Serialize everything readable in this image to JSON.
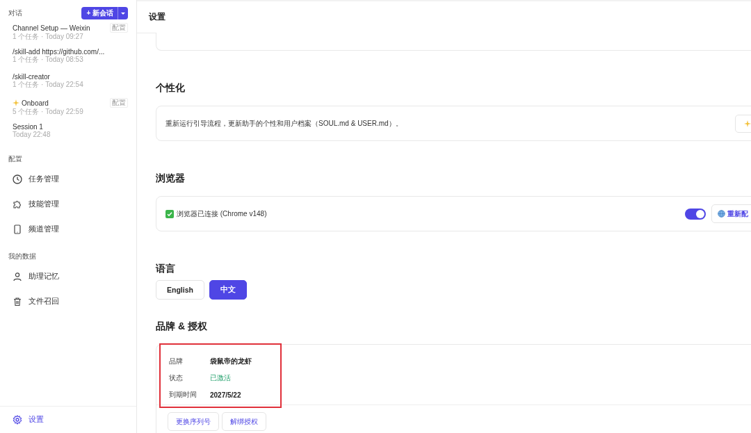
{
  "sidebar": {
    "conversations_label": "对话",
    "new_chat_button": {
      "label": "+ 新会话"
    },
    "sessions": [
      {
        "title": "Channel Setup — Weixin",
        "sparkle": false,
        "meta": "1 个任务 · Today 09:27",
        "tag": "配置"
      },
      {
        "title": "/skill-add https://github.com/...",
        "sparkle": false,
        "meta": "1 个任务 · Today 08:53"
      },
      {
        "title": "/skill-creator",
        "sparkle": false,
        "meta": "1 个任务 · Today 22:54"
      },
      {
        "title": "Onboard",
        "sparkle": true,
        "meta": "5 个任务 · Today 22:59",
        "tag": "配置"
      },
      {
        "title": "Session 1",
        "sparkle": false,
        "meta": "Today 22:48"
      }
    ],
    "sections": [
      {
        "label": "配置",
        "items": [
          {
            "label": "任务管理",
            "kind": "clock"
          },
          {
            "label": "技能管理",
            "kind": "puzzle"
          },
          {
            "label": "频道管理",
            "kind": "phone"
          }
        ]
      },
      {
        "label": "我的数据",
        "items": [
          {
            "label": "助理记忆",
            "kind": "user"
          },
          {
            "label": "文件召回",
            "kind": "trash"
          }
        ]
      }
    ],
    "settings": {
      "label": "设置",
      "selected": true
    }
  },
  "main": {
    "title": "设置",
    "personalization": {
      "heading": "个性化",
      "description": "重新运行引导流程，更新助手的个性和用户档案（SOUL.md & USER.md）。"
    },
    "browser": {
      "heading": "浏览器",
      "connected": true,
      "status": "浏览器已连接 (Chrome v148)",
      "toggle": {
        "on": true
      },
      "button": "重新配"
    },
    "language": {
      "heading": "语言",
      "options": [
        {
          "label": "English",
          "selected": false
        },
        {
          "label": "中文",
          "selected": true
        }
      ]
    },
    "license": {
      "heading": "品牌 & 授权",
      "highlighted": true,
      "fields": [
        {
          "label": "品牌",
          "value": "袋鼠帝的龙虾",
          "kind": "plain"
        },
        {
          "label": "状态",
          "value": "已激活",
          "kind": "success"
        },
        {
          "label": "到期时间",
          "value": "2027/5/22",
          "kind": "plain"
        }
      ],
      "buttons": [
        "更换序列号",
        "解绑授权"
      ]
    }
  }
}
